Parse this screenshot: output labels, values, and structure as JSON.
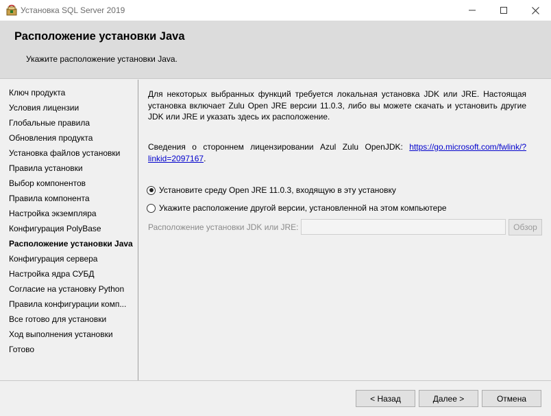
{
  "window": {
    "title": "Установка SQL Server 2019",
    "icon": "sql-server-setup-icon"
  },
  "header": {
    "title": "Расположение установки Java",
    "subtitle": "Укажите расположение установки Java."
  },
  "nav": {
    "items": [
      {
        "label": "Ключ продукта",
        "active": false
      },
      {
        "label": "Условия лицензии",
        "active": false
      },
      {
        "label": "Глобальные правила",
        "active": false
      },
      {
        "label": "Обновления продукта",
        "active": false
      },
      {
        "label": "Установка файлов установки",
        "active": false
      },
      {
        "label": "Правила установки",
        "active": false
      },
      {
        "label": "Выбор компонентов",
        "active": false
      },
      {
        "label": "Правила компонента",
        "active": false
      },
      {
        "label": "Настройка экземпляра",
        "active": false
      },
      {
        "label": "Конфигурация PolyBase",
        "active": false
      },
      {
        "label": "Расположение установки Java",
        "active": true
      },
      {
        "label": "Конфигурация сервера",
        "active": false
      },
      {
        "label": "Настройка ядра СУБД",
        "active": false
      },
      {
        "label": "Согласие на установку Python",
        "active": false
      },
      {
        "label": "Правила конфигурации комп...",
        "active": false
      },
      {
        "label": "Все готово для установки",
        "active": false
      },
      {
        "label": "Ход выполнения установки",
        "active": false
      },
      {
        "label": "Готово",
        "active": false
      }
    ]
  },
  "content": {
    "description": "Для некоторых выбранных функций требуется локальная установка JDK или JRE. Настоящая установка включает Zulu Open JRE версии 11.0.3, либо вы можете скачать и установить другие JDK или JRE и указать здесь их расположение.",
    "license_text": "Сведения о стороннем лицензировании Azul Zulu OpenJDK: ",
    "license_link": "https://go.microsoft.com/fwlink/?linkid=2097167",
    "license_suffix": ".",
    "option_included": "Установите среду Open JRE 11.0.3, входящую в эту установку",
    "option_other": "Укажите расположение другой версии, установленной на этом компьютере",
    "selected_option": "included",
    "path_label": "Расположение установки JDK или JRE:",
    "path_value": "",
    "browse_label": "Обзор"
  },
  "footer": {
    "back_label": "< Назад",
    "next_label": "Далее >",
    "cancel_label": "Отмена"
  }
}
